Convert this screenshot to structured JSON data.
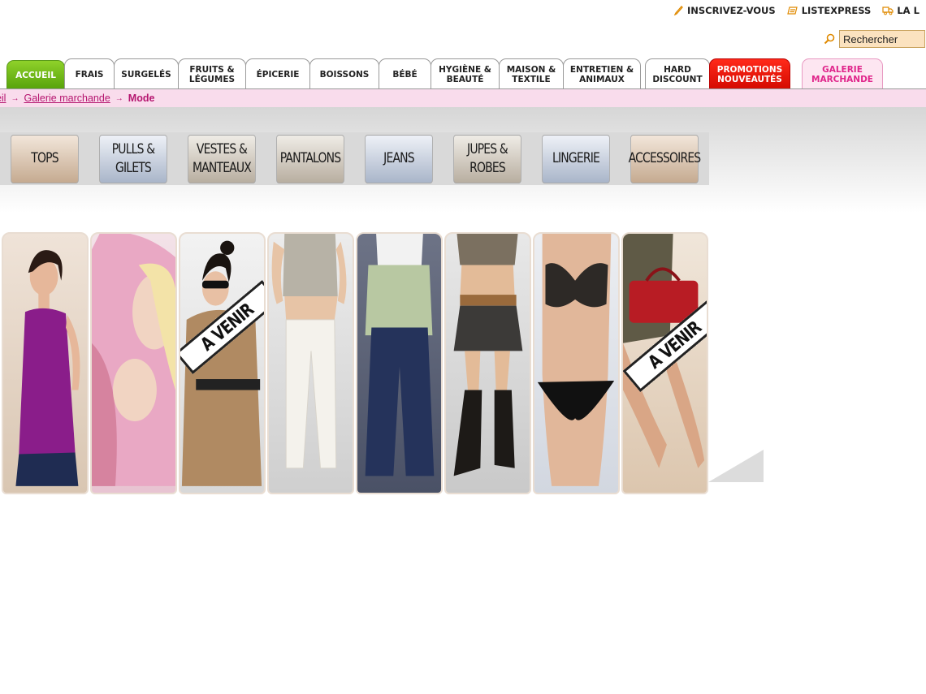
{
  "top_links": [
    {
      "label": "INSCRIVEZ-VOUS",
      "icon": "pencil-icon"
    },
    {
      "label": "LISTEXPRESS",
      "icon": "list-icon"
    },
    {
      "label": "LA L",
      "icon": "truck-icon"
    }
  ],
  "search": {
    "placeholder": "Rechercher",
    "icon": "search-icon"
  },
  "tabs": [
    {
      "label": "ACCUEIL"
    },
    {
      "label": "FRAIS"
    },
    {
      "label": "SURGELÉS"
    },
    {
      "label": "FRUITS &\nLÉGUMES"
    },
    {
      "label": "ÉPICERIE"
    },
    {
      "label": "BOISSONS"
    },
    {
      "label": "BÉBÉ"
    },
    {
      "label": "HYGIÈNE &\nBEAUTÉ"
    },
    {
      "label": "MAISON &\nTEXTILE"
    },
    {
      "label": "ENTRETIEN &\nANIMAUX"
    },
    {
      "label": "HARD\nDISCOUNT"
    },
    {
      "label": "PROMOTIONS\nNOUVEAUTÉS"
    },
    {
      "label": "GALERIE\nMARCHANDE"
    }
  ],
  "breadcrumb": {
    "items": [
      "ueil",
      "Galerie marchande"
    ],
    "current": "Mode",
    "separator": "→"
  },
  "categories": [
    {
      "label": "TOPS"
    },
    {
      "label": "PULLS &\nGILETS"
    },
    {
      "label": "VESTES &\nMANTEAUX"
    },
    {
      "label": "PANTALONS"
    },
    {
      "label": "JEANS"
    },
    {
      "label": "JUPES &\nROBES"
    },
    {
      "label": "LINGERIE"
    },
    {
      "label": "ACCESSOIRES"
    }
  ],
  "coming_soon": "A VENIR",
  "colors": {
    "green": "#6cb81a",
    "red": "#e2100a",
    "pink": "#e0268b",
    "pink_bg": "#f9dcec",
    "search_bg": "#fbe2bf"
  }
}
